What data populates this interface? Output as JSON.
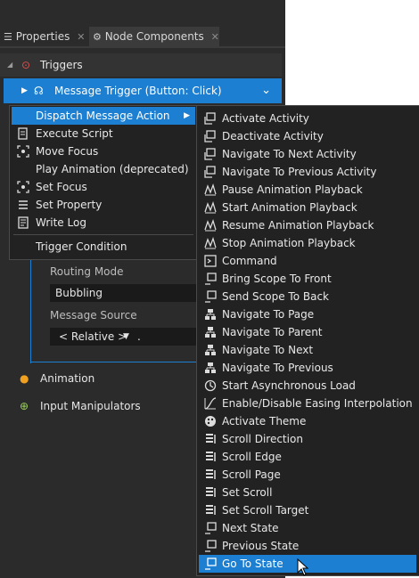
{
  "tabs": [
    {
      "label": "Properties",
      "close": "✕"
    },
    {
      "label": "Node Components",
      "close": "✕"
    }
  ],
  "sections": {
    "triggers": "Triggers",
    "animation": "Animation",
    "input_manipulators": "Input Manipulators"
  },
  "message_trigger": {
    "label": "Message Trigger (Button: Click)"
  },
  "fields": {
    "routing_mode_label": "Routing Mode",
    "routing_mode_value": "Bubbling",
    "message_source_label": "Message Source",
    "message_source_value": "< Relative >",
    "message_source_suffix": "."
  },
  "context_menu": [
    {
      "label": "Dispatch Message Action",
      "icon": "none",
      "submenu": true
    },
    {
      "label": "Execute Script",
      "icon": "script-icon"
    },
    {
      "label": "Move Focus",
      "icon": "focus-icon"
    },
    {
      "label": "Play Animation (deprecated)",
      "icon": "none"
    },
    {
      "label": "Set Focus",
      "icon": "focus-icon"
    },
    {
      "label": "Set Property",
      "icon": "property-icon"
    },
    {
      "label": "Write Log",
      "icon": "log-icon"
    },
    {
      "label": "Trigger Condition",
      "icon": "none"
    }
  ],
  "submenu": [
    "Activate Activity",
    "Deactivate Activity",
    "Navigate To Next Activity",
    "Navigate To Previous Activity",
    "Pause Animation Playback",
    "Start Animation Playback",
    "Resume Animation Playback",
    "Stop Animation Playback",
    "Command",
    "Bring Scope To Front",
    "Send Scope To Back",
    "Navigate To Page",
    "Navigate To Parent",
    "Navigate To Next",
    "Navigate To Previous",
    "Start Asynchronous Load",
    "Enable/Disable Easing Interpolation",
    "Activate Theme",
    "Scroll Direction",
    "Scroll Edge",
    "Scroll Page",
    "Set Scroll",
    "Set Scroll Target",
    "Next State",
    "Previous State",
    "Go To State"
  ],
  "colors": {
    "accent": "#1c7fd1",
    "panel": "#2b2b2b",
    "menu": "#222222"
  }
}
